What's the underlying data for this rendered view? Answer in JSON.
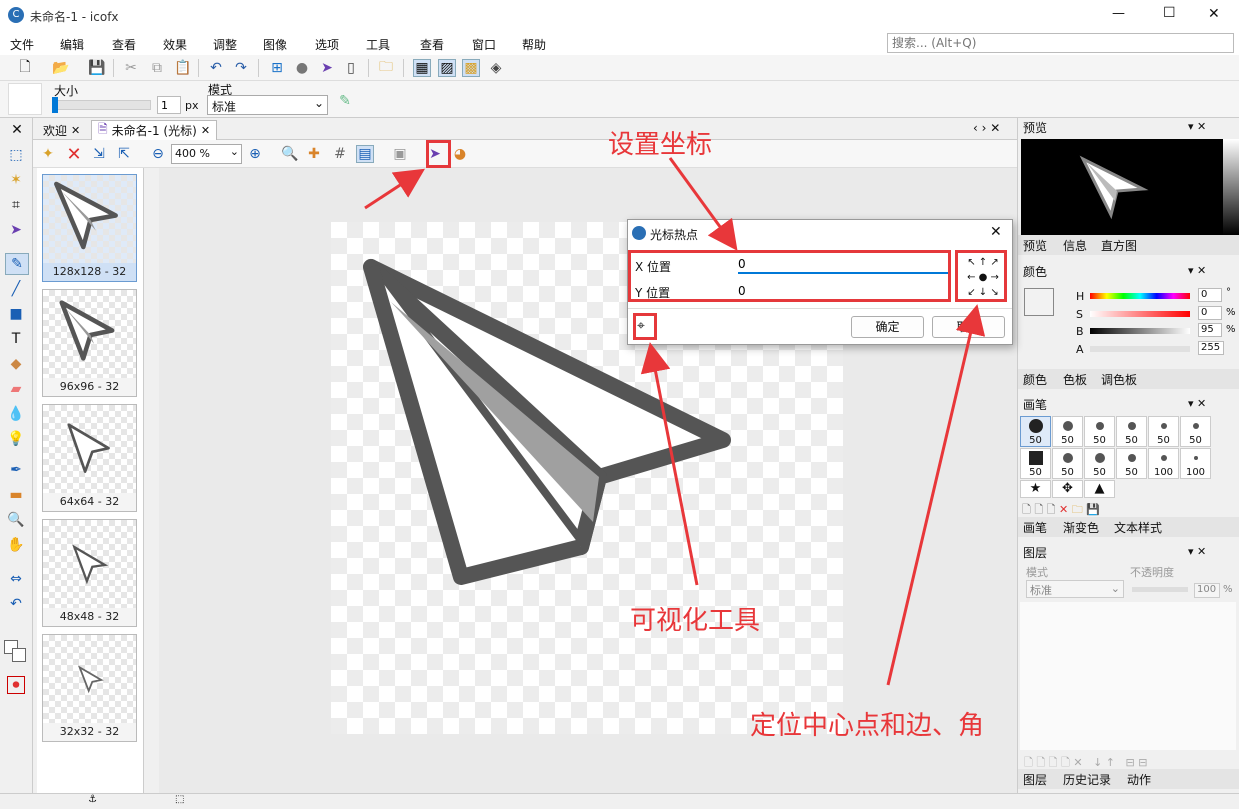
{
  "window": {
    "title": "未命名-1 - icofx",
    "min": "—",
    "max": "☐",
    "close": "✕"
  },
  "menu": [
    "文件",
    "编辑",
    "查看",
    "效果",
    "调整",
    "图像",
    "选项",
    "工具",
    "查看",
    "窗口",
    "帮助"
  ],
  "search": {
    "placeholder": "搜索... (Alt+Q)"
  },
  "toolopts": {
    "size_label": "大小",
    "size_value": "1",
    "size_unit": "px",
    "mode_label": "模式",
    "mode_value": "标准"
  },
  "tabs": [
    {
      "label": "欢迎"
    },
    {
      "label": "未命名-1 (光标)"
    }
  ],
  "zoom": "400 %",
  "thumbnails": [
    {
      "label": "128x128 - 32"
    },
    {
      "label": "96x96 - 32"
    },
    {
      "label": "64x64 - 32"
    },
    {
      "label": "48x48 - 32"
    },
    {
      "label": "32x32 - 32"
    }
  ],
  "dialog": {
    "title": "光标热点",
    "x_label": "X 位置",
    "x_value": "0",
    "y_label": "Y 位置",
    "y_value": "0",
    "ok": "确定",
    "cancel": "取消"
  },
  "right": {
    "preview": {
      "title": "预览",
      "tabs": [
        "预览",
        "信息",
        "直方图"
      ]
    },
    "color": {
      "title": "颜色",
      "H": "0",
      "S": "0",
      "B": "95",
      "A": "255",
      "H_label": "H",
      "S_label": "S",
      "B_label": "B",
      "A_label": "A",
      "deg": "°",
      "pct1": "%",
      "pct2": "%",
      "tabs": [
        "颜色",
        "色板",
        "调色板"
      ]
    },
    "brush": {
      "title": "画笔",
      "sizes": [
        "50",
        "50",
        "50",
        "50",
        "50",
        "50",
        "50",
        "50",
        "50",
        "50",
        "100",
        "100"
      ],
      "tabs": [
        "画笔",
        "渐变色",
        "文本样式"
      ]
    },
    "layers": {
      "title": "图层",
      "mode_label": "模式",
      "mode_value": "标准",
      "opacity_label": "不透明度",
      "opacity_value": "100",
      "pct": "%",
      "tabs": [
        "图层",
        "历史记录",
        "动作"
      ]
    }
  },
  "annotations": {
    "set_coord": "设置坐标",
    "visual_tool": "可视化工具",
    "locate": "定位中心点和边、角"
  },
  "colors": {
    "accent": "#0078d7",
    "annot": "#e8373a"
  }
}
